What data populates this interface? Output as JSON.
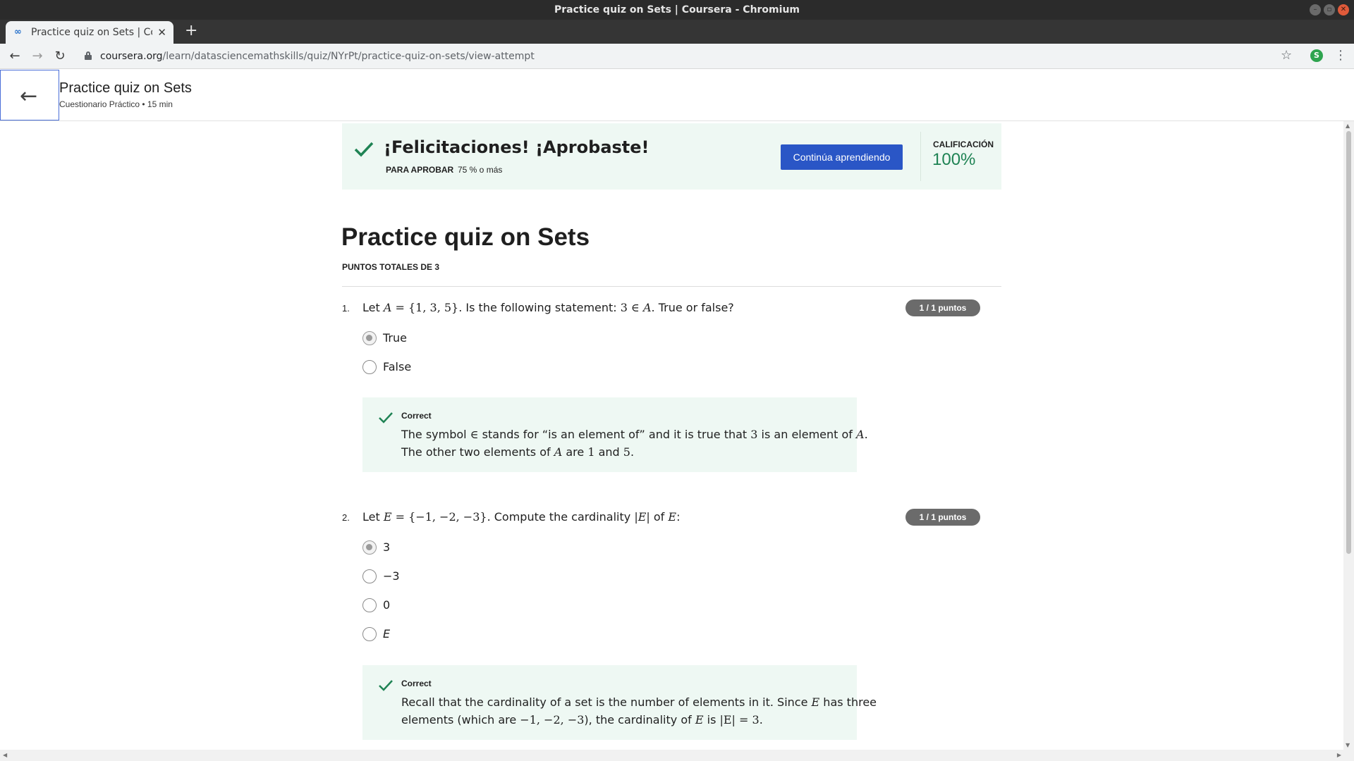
{
  "window": {
    "title": "Practice quiz on Sets | Coursera - Chromium"
  },
  "browser": {
    "tab_title": "Practice quiz on Sets | Coursera",
    "url_host": "coursera.org",
    "url_path": "/learn/datasciencemathskills/quiz/NYrPt/practice-quiz-on-sets/view-attempt",
    "profile_initial": "S"
  },
  "header": {
    "title": "Practice quiz on Sets",
    "subtitle": "Cuestionario Práctico • 15 min"
  },
  "banner": {
    "congrats": "¡Felicitaciones! ¡Aprobaste!",
    "pass_label": "PARA APROBAR",
    "pass_value": "75 % o más",
    "continue_label": "Continúa aprendiendo",
    "grade_label": "CALIFICACIÓN",
    "grade_value": "100%",
    "accent_color": "#1f8354"
  },
  "quiz": {
    "title": "Practice quiz on Sets",
    "total_points": "PUNTOS TOTALES DE 3"
  },
  "questions": [
    {
      "number": "1.",
      "text_parts": [
        "Let ",
        "A",
        " = {1, 3, 5}",
        ". Is the following statement: ",
        "3 ∈ ",
        "A",
        ". True or false?"
      ],
      "points": "1 / 1 puntos",
      "options": [
        "True",
        "False"
      ],
      "selected_index": 0,
      "feedback_title": "Correct",
      "feedback_line1": [
        "The symbol ",
        "∈",
        " stands for “is an element of” and it is true that ",
        "3",
        " is an element of ",
        "A",
        "."
      ],
      "feedback_line2": [
        "The other two elements of ",
        "A",
        " are ",
        "1",
        " and ",
        "5",
        "."
      ]
    },
    {
      "number": "2.",
      "text_parts": [
        "Let ",
        "E",
        " = {−1, −2, −3}",
        ". Compute the cardinality ",
        "|E|",
        " of ",
        "E",
        ":"
      ],
      "points": "1 / 1 puntos",
      "options": [
        "3",
        "−3",
        "0",
        "E"
      ],
      "selected_index": 0,
      "feedback_title": "Correct",
      "feedback_line1": [
        "Recall that the cardinality of a set is the number of elements in it. Since ",
        "E",
        " has three"
      ],
      "feedback_line2": [
        "elements (which are ",
        "−1, −2, −3",
        "), the cardinality of ",
        "E",
        " is ",
        "|E| = 3",
        "."
      ]
    }
  ],
  "colors": {
    "primary_button": "#2a56c6",
    "success_bg": "#eef8f3",
    "badge_bg": "#6b6b6b"
  }
}
